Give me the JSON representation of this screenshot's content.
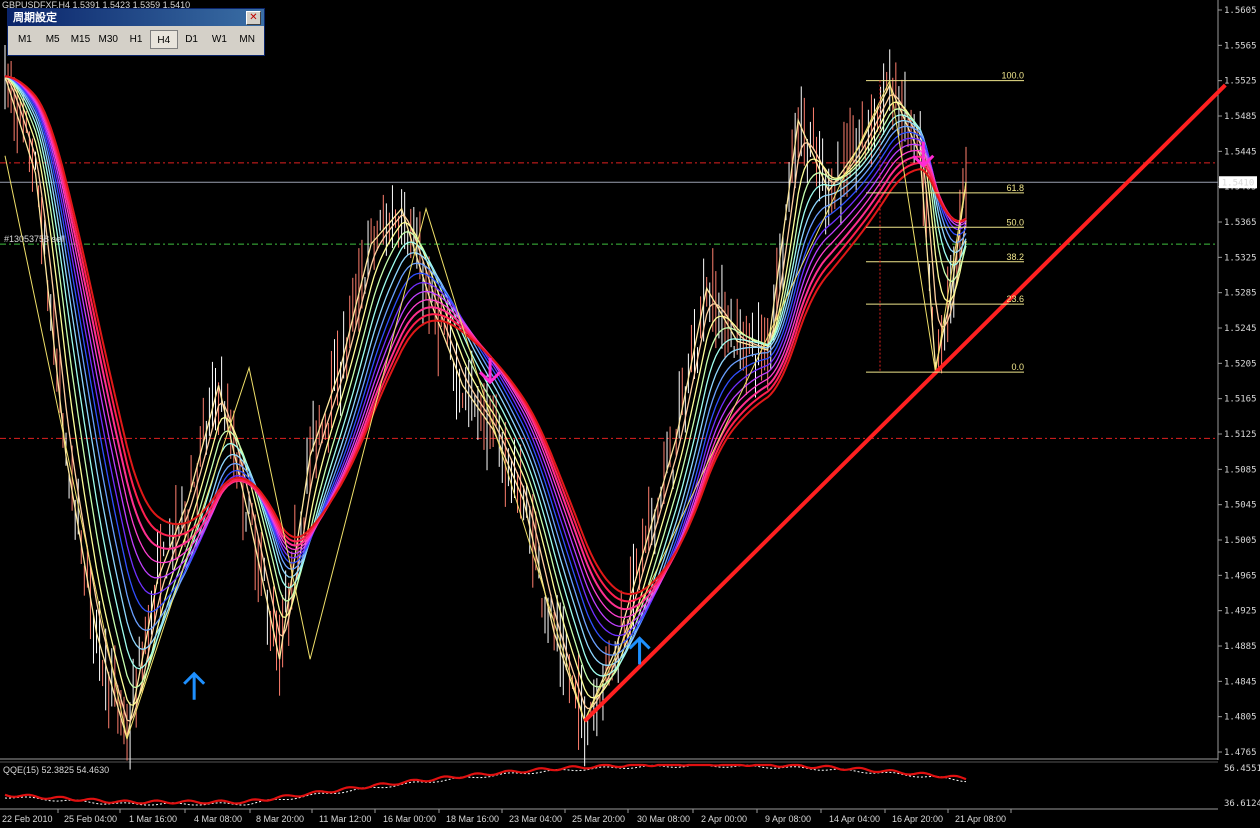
{
  "chart_header": "GBPUSDFXF,H4  1.5391 1.5423 1.5359 1.5410",
  "trade_label": "#13053758 sell",
  "current_price_label": "1.5410",
  "period_panel": {
    "title": "周期設定",
    "close_glyph": "✕",
    "buttons": [
      {
        "label": "M1",
        "active": false
      },
      {
        "label": "M5",
        "active": false
      },
      {
        "label": "M15",
        "active": false
      },
      {
        "label": "M30",
        "active": false
      },
      {
        "label": "H1",
        "active": false
      },
      {
        "label": "H4",
        "active": true
      },
      {
        "label": "D1",
        "active": false
      },
      {
        "label": "W1",
        "active": false
      },
      {
        "label": "MN",
        "active": false
      }
    ]
  },
  "indicator": {
    "title": "QQE(15) 52.3825 54.4630",
    "scale_top": "56.4551",
    "scale_bottom": "36.6124"
  },
  "colors": {
    "background": "#000000",
    "candle": "#ff7f6e",
    "trendline": "#ff2020",
    "zigzag": "#f0e06a",
    "fib": "#f0e68c",
    "arrow_up": "#1e90ff",
    "arrow_down": "#ff2ad4",
    "red_dash": "#e02020",
    "green_dash": "#3fbf3f",
    "grid_axis": "#9a9a9a"
  },
  "chart_data": {
    "type": "line",
    "symbol": "GBPUSDFXF",
    "timeframe": "H4",
    "x_tick_labels": [
      "22 Feb 2010",
      "25 Feb 04:00",
      "1 Mar 16:00",
      "4 Mar 08:00",
      "8 Mar 20:00",
      "11 Mar 12:00",
      "16 Mar 00:00",
      "18 Mar 16:00",
      "23 Mar 04:00",
      "25 Mar 20:00",
      "30 Mar 08:00",
      "2 Apr 00:00",
      "9 Apr 08:00",
      "14 Apr 04:00",
      "16 Apr 20:00",
      "21 Apr 08:00"
    ],
    "y_tick_labels": [
      "1.5605",
      "1.5565",
      "1.5525",
      "1.5485",
      "1.5445",
      "1.5405",
      "1.5365",
      "1.5325",
      "1.5285",
      "1.5245",
      "1.5205",
      "1.5165",
      "1.5125",
      "1.5085",
      "1.5045",
      "1.5005",
      "1.4965",
      "1.4925",
      "1.4885",
      "1.4845",
      "1.4805",
      "1.4765"
    ],
    "ylim": [
      1.4765,
      1.5605
    ],
    "price_series": [
      [
        0,
        1.553
      ],
      [
        10,
        1.542
      ],
      [
        20,
        1.51
      ],
      [
        30,
        1.49
      ],
      [
        40,
        1.478
      ],
      [
        50,
        1.496
      ],
      [
        60,
        1.505
      ],
      [
        70,
        1.518
      ],
      [
        80,
        1.503
      ],
      [
        90,
        1.487
      ],
      [
        100,
        1.51
      ],
      [
        110,
        1.52
      ],
      [
        120,
        1.534
      ],
      [
        130,
        1.538
      ],
      [
        140,
        1.527
      ],
      [
        150,
        1.518
      ],
      [
        160,
        1.513
      ],
      [
        170,
        1.505
      ],
      [
        180,
        1.49
      ],
      [
        190,
        1.48
      ],
      [
        200,
        1.488
      ],
      [
        210,
        1.5
      ],
      [
        220,
        1.512
      ],
      [
        230,
        1.529
      ],
      [
        240,
        1.523
      ],
      [
        250,
        1.522
      ],
      [
        260,
        1.548
      ],
      [
        270,
        1.54
      ],
      [
        280,
        1.545
      ],
      [
        290,
        1.552
      ],
      [
        300,
        1.544
      ],
      [
        305,
        1.52
      ],
      [
        310,
        1.528
      ],
      [
        315,
        1.541
      ]
    ],
    "fibonacci": {
      "levels": [
        {
          "label": "100.0",
          "value": 1.5525
        },
        {
          "label": "61.8",
          "value": 1.5398
        },
        {
          "label": "50.0",
          "value": 1.5359
        },
        {
          "label": "38.2",
          "value": 1.532
        },
        {
          "label": "23.6",
          "value": 1.5272
        },
        {
          "label": "0.0",
          "value": 1.5195
        }
      ]
    },
    "horizontal_levels": [
      {
        "style": "red-dash",
        "value": 1.5432
      },
      {
        "style": "green-dash",
        "value": 1.534
      },
      {
        "style": "red-dash",
        "value": 1.512
      },
      {
        "style": "current-price",
        "value": 1.541
      }
    ],
    "trendline": {
      "from": [
        190,
        1.48
      ],
      "to": [
        400,
        1.552
      ]
    },
    "zigzag": [
      [
        0,
        1.544
      ],
      [
        40,
        1.478
      ],
      [
        80,
        1.52
      ],
      [
        100,
        1.487
      ],
      [
        138,
        1.538
      ],
      [
        190,
        1.48
      ],
      [
        290,
        1.5525
      ],
      [
        305,
        1.5195
      ],
      [
        315,
        1.541
      ]
    ],
    "signals": [
      {
        "type": "up",
        "at": [
          62,
          1.484
        ]
      },
      {
        "type": "up",
        "at": [
          208,
          1.488
        ]
      },
      {
        "type": "down",
        "at": [
          159,
          1.5195
        ]
      },
      {
        "type": "down",
        "at": [
          301,
          1.544
        ]
      }
    ]
  }
}
